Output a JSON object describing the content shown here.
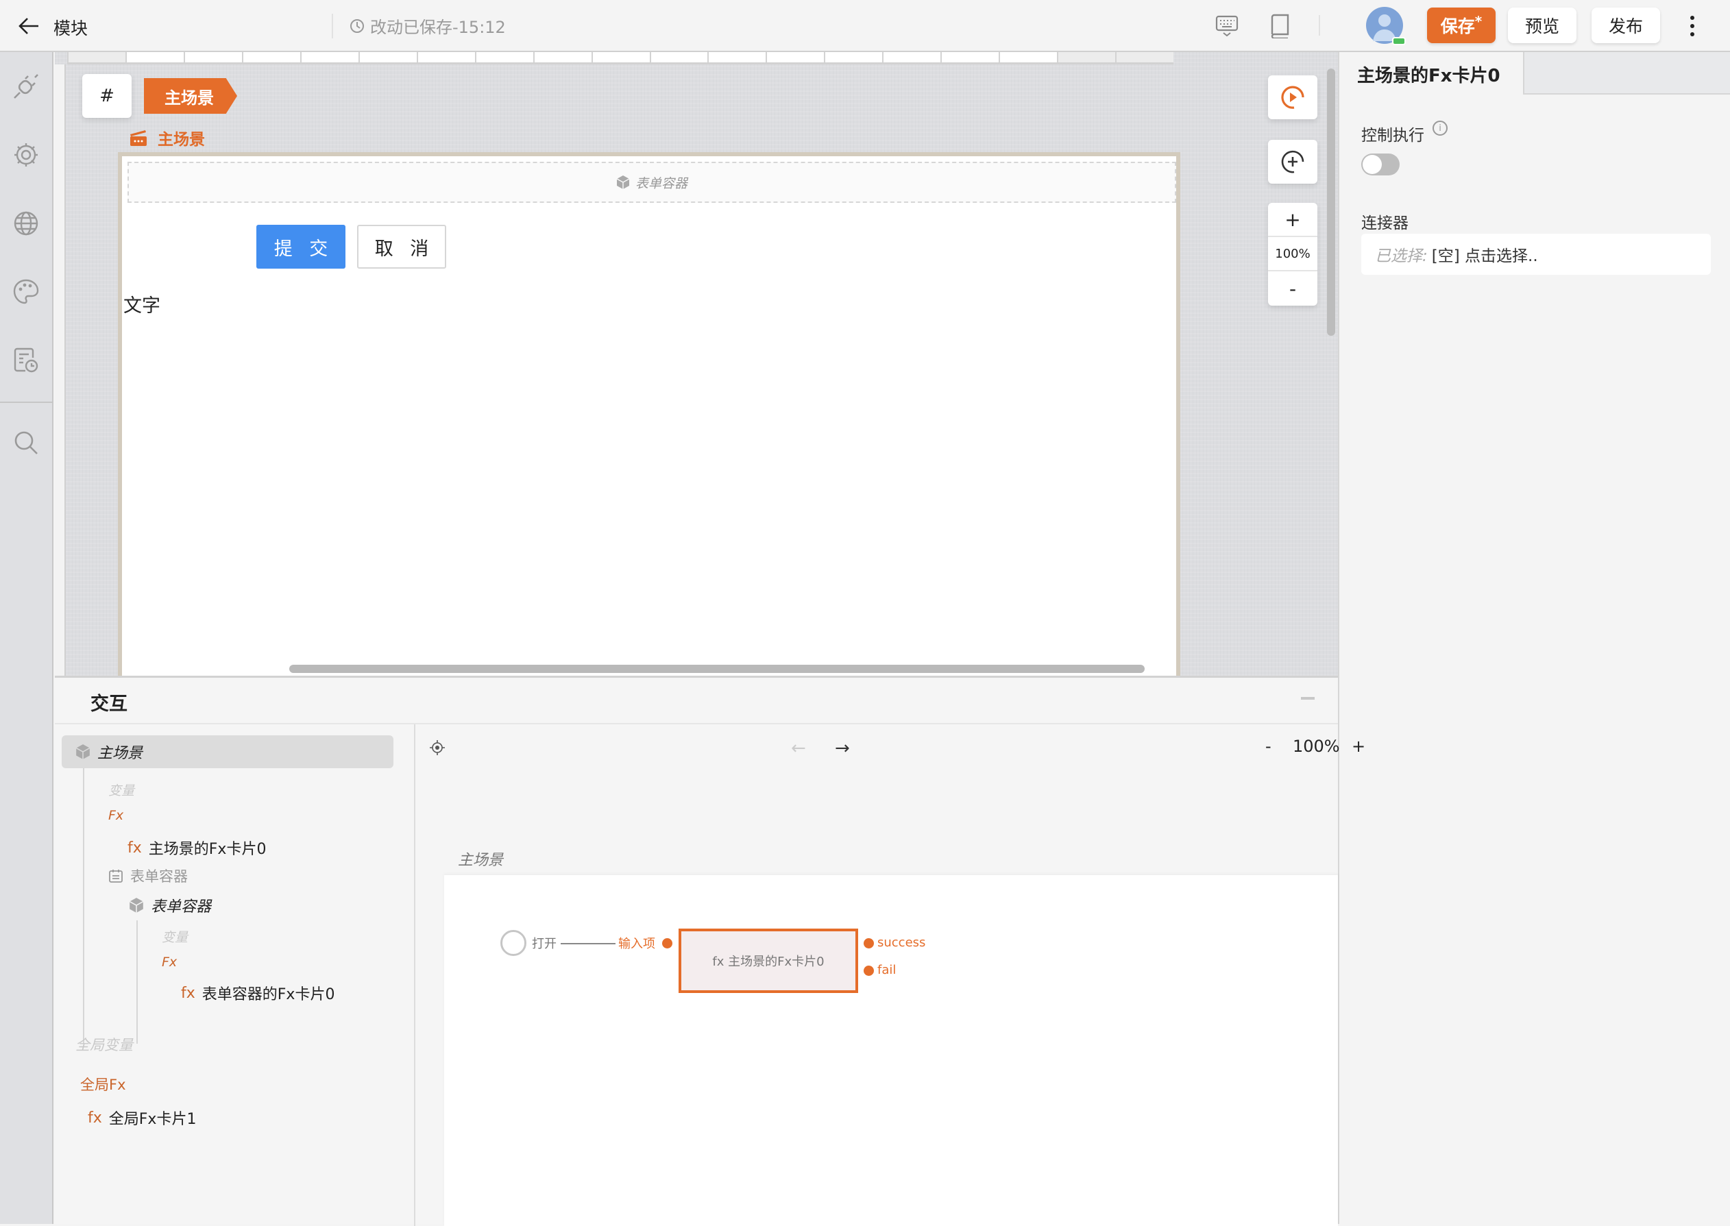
{
  "header": {
    "back_icon": "arrow-left-icon",
    "title": "模块",
    "save_status": "改动已保存-15:12",
    "clock_icon": "clock-icon",
    "keyboard_icon": "keyboard-icon",
    "book_icon": "book-icon",
    "avatar_icon": "user-avatar",
    "save_label": "保存",
    "save_dirty_mark": "*",
    "preview_label": "预览",
    "publish_label": "发布",
    "more_icon": "more-vertical-icon"
  },
  "sidebar": {
    "items": [
      {
        "name": "plug-icon"
      },
      {
        "name": "gear-icon"
      },
      {
        "name": "globe-icon"
      },
      {
        "name": "palette-icon"
      },
      {
        "name": "log-history-icon"
      },
      {
        "name": "search-icon"
      }
    ]
  },
  "canvas": {
    "hash_label": "#",
    "scene_tab": "主场景",
    "scene_label": "主场景",
    "form_container_label": "表单容器",
    "submit_label": "提 交",
    "cancel_label": "取 消",
    "text_widget": "文字",
    "zoom_in": "+",
    "zoom_value": "100%",
    "zoom_out": "-"
  },
  "right_panel": {
    "title": "主场景的Fx卡片0",
    "control_exec_label": "控制执行",
    "control_exec_enabled": false,
    "connector_label": "连接器",
    "connector_prefix": "已选择:",
    "connector_value": "[空] 点击选择.."
  },
  "bottom_panel": {
    "title": "交互",
    "tree": {
      "root": "主场景",
      "root_vars": "变量",
      "root_fx": "Fx",
      "root_fx_card": "主场景的Fx卡片0",
      "form_container_group": "表单容器",
      "form_container": "表单容器",
      "fc_vars": "变量",
      "fc_fx": "Fx",
      "fc_fx_card": "表单容器的Fx卡片0",
      "global_vars": "全局变量",
      "global_fx": "全局Fx",
      "global_fx_card": "全局Fx卡片1",
      "fx_prefix": "fx"
    },
    "flow": {
      "zoom_out": "-",
      "zoom_value": "100%",
      "zoom_in": "+",
      "back_arrow": "←",
      "forward_arrow": "→",
      "scene_label": "主场景",
      "open_label": "打开",
      "input_label": "输入项",
      "node_label": "fx 主场景的Fx卡片0",
      "success_label": "success",
      "fail_label": "fail"
    }
  },
  "colors": {
    "accent": "#e56d2a",
    "primary_button": "#428ef0",
    "toggle_off": "#bdbdbd",
    "online_badge": "#4cc05a"
  }
}
